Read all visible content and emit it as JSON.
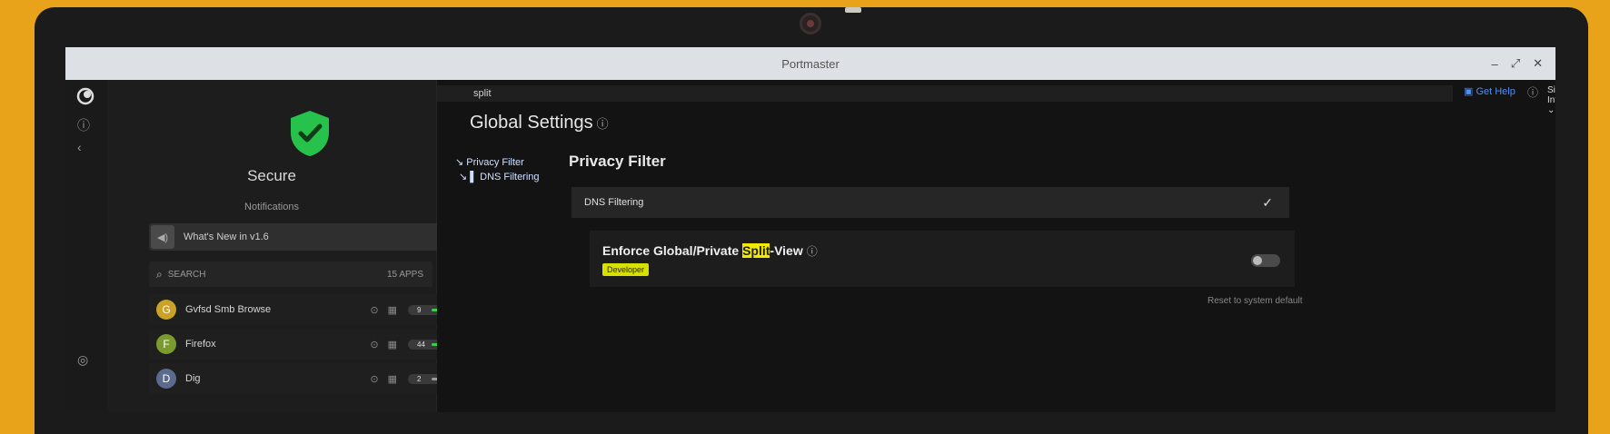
{
  "window": {
    "title": "Portmaster",
    "controls": [
      "–",
      "⤢",
      "✕"
    ]
  },
  "rail": {
    "top_icon": "app-logo-icon",
    "items": [
      "ⓘ",
      "‹"
    ],
    "bottom": "◎"
  },
  "sidebar": {
    "status": "Secure",
    "notifications_heading": "Notifications",
    "news_item": "What's New in v1.6",
    "search_placeholder": "SEARCH",
    "app_count": "15 APPS",
    "apps": [
      {
        "initial": "G",
        "name": "Gvfsd Smb Browse",
        "count": "9",
        "color": "#c9a227",
        "bar_color": "#3ccf4e"
      },
      {
        "initial": "F",
        "name": "Firefox",
        "count": "44",
        "color": "#7a9b2e",
        "bar_color": "#3ccf4e"
      },
      {
        "initial": "D",
        "name": "Dig",
        "count": "2",
        "color": "#5b6b8e",
        "bar_color": "#9a9a9a"
      }
    ]
  },
  "main": {
    "search_value": "split",
    "help_label": "Get Help",
    "interface_mode": "Simple Interface",
    "page_title": "Global Settings",
    "toc": [
      "Privacy Filter",
      "DNS Filtering"
    ],
    "section_title": "Privacy Filter",
    "subsection": "DNS Filtering",
    "setting": {
      "before": "Enforce Global/Private ",
      "highlight": "Split",
      "after": "-View",
      "badge": "Developer"
    },
    "reset_label": "Reset to system default"
  },
  "colors": {
    "accent": "#4f8ff0",
    "secure": "#27c24c",
    "highlight": "#f2ea00"
  }
}
